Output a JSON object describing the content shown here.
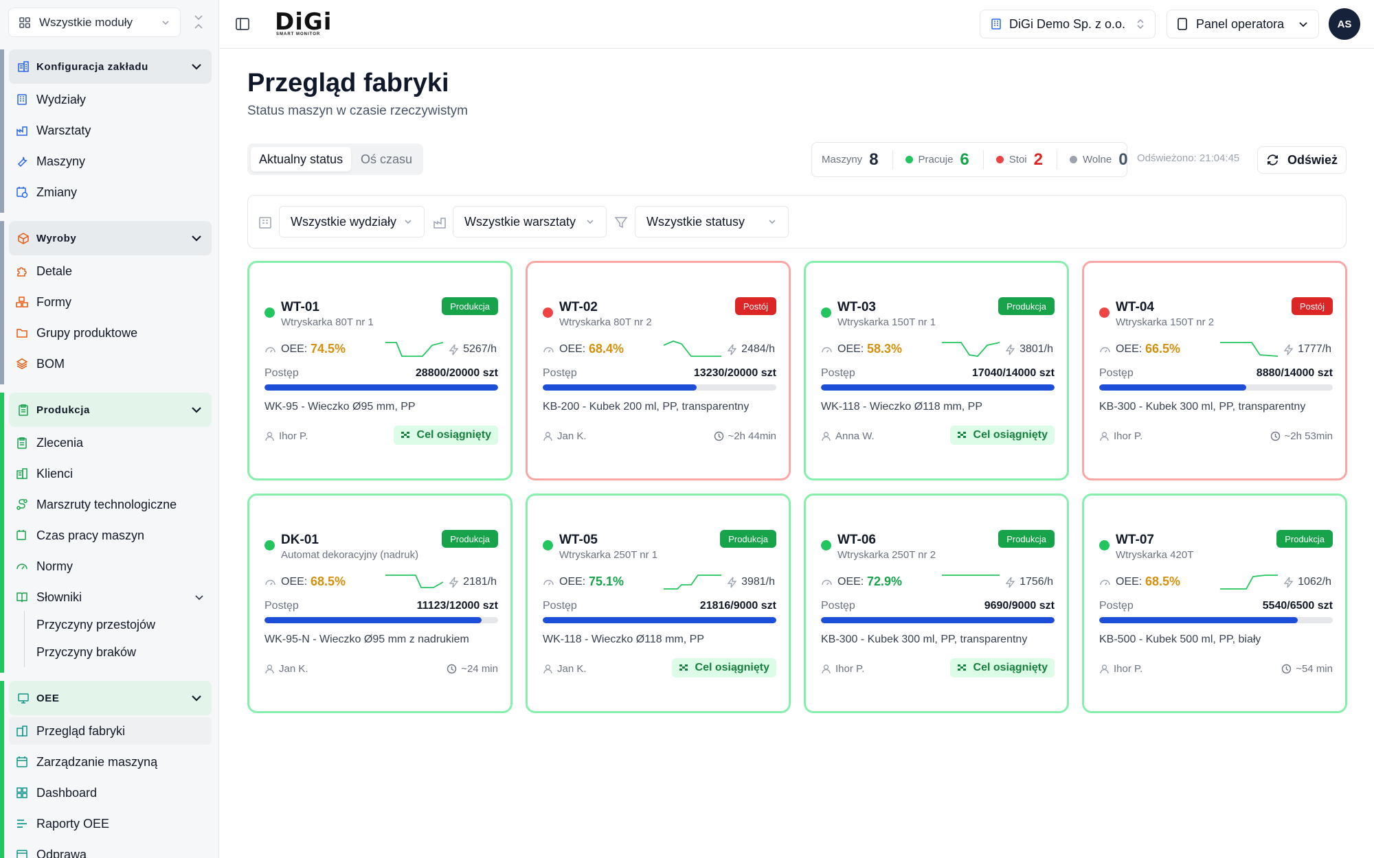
{
  "sidebar": {
    "module_select": "Wszystkie moduły",
    "sections": [
      {
        "title": "Konfiguracja zakładu",
        "items": [
          "Wydziały",
          "Warsztaty",
          "Maszyny",
          "Zmiany"
        ]
      },
      {
        "title": "Wyroby",
        "items": [
          "Detale",
          "Formy",
          "Grupy produktowe",
          "BOM"
        ]
      },
      {
        "title": "Produkcja",
        "items": [
          "Zlecenia",
          "Klienci",
          "Marszruty technologiczne",
          "Czas pracy maszyn",
          "Normy",
          "Słowniki"
        ],
        "sub_items": [
          "Przyczyny przestojów",
          "Przyczyny braków"
        ]
      },
      {
        "title": "OEE",
        "items": [
          "Przegląd fabryki",
          "Zarządzanie maszyną",
          "Dashboard",
          "Raporty OEE",
          "Odprawa"
        ]
      }
    ]
  },
  "header": {
    "logo": "DiGi",
    "logo_sub": "SMART MONITOR",
    "company": "DiGi Demo Sp. z o.o.",
    "panel": "Panel operatora",
    "avatar": "AS"
  },
  "page": {
    "title": "Przegląd fabryki",
    "subtitle": "Status maszyn w czasie rzeczywistym",
    "tabs": [
      "Aktualny status",
      "Oś czasu"
    ]
  },
  "stats": {
    "machines_label": "Maszyny",
    "machines": "8",
    "working_label": "Pracuje",
    "working": "6",
    "stopped_label": "Stoi",
    "stopped": "2",
    "free_label": "Wolne",
    "free": "0",
    "refreshed": "Odświeżono: 21:04:45",
    "refresh_button": "Odśwież"
  },
  "filters": {
    "department": "Wszystkie wydziały",
    "workshop": "Wszystkie warsztaty",
    "status": "Wszystkie statusy"
  },
  "colors": {
    "green": "#16a34a",
    "red": "#dc2626",
    "blue_progress": "#1d4ed8",
    "oee_orange": "#d4900a",
    "oee_green": "#16a34a"
  },
  "labels": {
    "oee": "OEE:",
    "progress": "Postęp",
    "goal": "Cel osiągnięty"
  },
  "machines": [
    {
      "id": "WT-01",
      "type": "Wtryskarka 80T nr 1",
      "status": "Produkcja",
      "oee": "74.5%",
      "oee_level": "warn",
      "rate": "5267/h",
      "progress": "28800/20000 szt",
      "progress_fraction": 1.0,
      "product": "WK-95 - Wieczko Ø95 mm, PP",
      "operator": "Ihor P.",
      "goal": true,
      "eta": ""
    },
    {
      "id": "WT-02",
      "type": "Wtryskarka 80T nr 2",
      "status": "Postój",
      "oee": "68.4%",
      "oee_level": "warn",
      "rate": "2484/h",
      "progress": "13230/20000 szt",
      "progress_fraction": 0.66,
      "product": "KB-200 - Kubek 200 ml, PP, transparentny",
      "operator": "Jan K.",
      "goal": false,
      "eta": "~2h 44min"
    },
    {
      "id": "WT-03",
      "type": "Wtryskarka 150T nr 1",
      "status": "Produkcja",
      "oee": "58.3%",
      "oee_level": "warn",
      "rate": "3801/h",
      "progress": "17040/14000 szt",
      "progress_fraction": 1.0,
      "product": "WK-118 - Wieczko Ø118 mm, PP",
      "operator": "Anna W.",
      "goal": true,
      "eta": ""
    },
    {
      "id": "WT-04",
      "type": "Wtryskarka 150T nr 2",
      "status": "Postój",
      "oee": "66.5%",
      "oee_level": "warn",
      "rate": "1777/h",
      "progress": "8880/14000 szt",
      "progress_fraction": 0.63,
      "product": "KB-300 - Kubek 300 ml, PP, transparentny",
      "operator": "Ihor P.",
      "goal": false,
      "eta": "~2h 53min"
    },
    {
      "id": "DK-01",
      "type": "Automat dekoracyjny (nadruk)",
      "status": "Produkcja",
      "oee": "68.5%",
      "oee_level": "warn",
      "rate": "2181/h",
      "progress": "11123/12000 szt",
      "progress_fraction": 0.93,
      "product": "WK-95-N - Wieczko Ø95 mm z nadrukiem",
      "operator": "Jan K.",
      "goal": false,
      "eta": "~24 min"
    },
    {
      "id": "WT-05",
      "type": "Wtryskarka 250T nr 1",
      "status": "Produkcja",
      "oee": "75.1%",
      "oee_level": "good",
      "rate": "3981/h",
      "progress": "21816/9000 szt",
      "progress_fraction": 1.0,
      "product": "WK-118 - Wieczko Ø118 mm, PP",
      "operator": "Jan K.",
      "goal": true,
      "eta": ""
    },
    {
      "id": "WT-06",
      "type": "Wtryskarka 250T nr 2",
      "status": "Produkcja",
      "oee": "72.9%",
      "oee_level": "good",
      "rate": "1756/h",
      "progress": "9690/9000 szt",
      "progress_fraction": 1.0,
      "product": "KB-300 - Kubek 300 ml, PP, transparentny",
      "operator": "Ihor P.",
      "goal": true,
      "eta": ""
    },
    {
      "id": "WT-07",
      "type": "Wtryskarka 420T",
      "status": "Produkcja",
      "oee": "68.5%",
      "oee_level": "warn",
      "rate": "1062/h",
      "progress": "5540/6500 szt",
      "progress_fraction": 0.85,
      "product": "KB-500 - Kubek 500 ml, PP, biały",
      "operator": "Ihor P.",
      "goal": false,
      "eta": "~54 min"
    }
  ]
}
